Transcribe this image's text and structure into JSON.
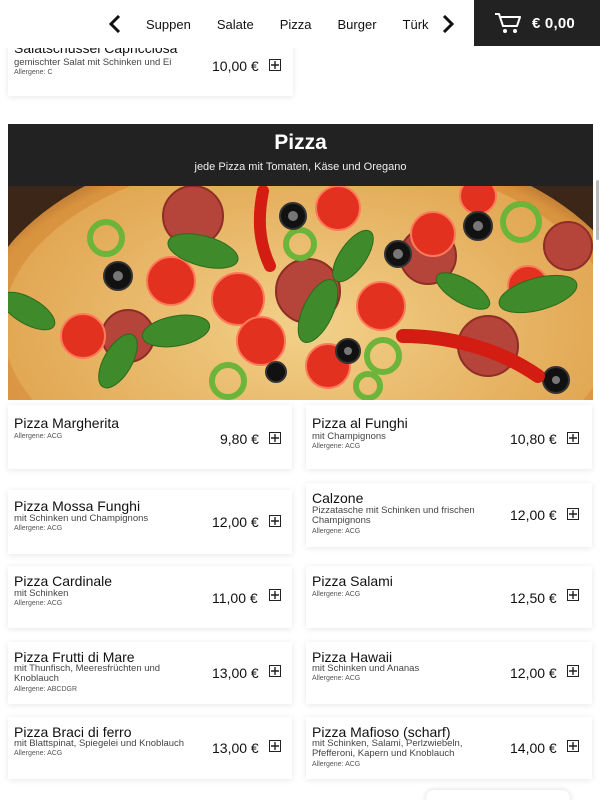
{
  "nav": {
    "categories": [
      "Suppen",
      "Salate",
      "Pizza",
      "Burger",
      "Türk"
    ]
  },
  "cart": {
    "total": "€ 0,00"
  },
  "previous_item": {
    "name": "Salatschüssel Capricciosa",
    "description": "gemischter Salat mit Schinken und Ei",
    "allergens": "Allergene: C",
    "price": "10,00 €"
  },
  "section": {
    "title": "Pizza",
    "subtitle": "jede Pizza mit Tomaten, Käse und Oregano"
  },
  "items": [
    {
      "name": "Pizza Margherita",
      "description": "",
      "allergens": "Allergene: ACG",
      "price": "9,80 €"
    },
    {
      "name": "Pizza al Funghi",
      "description": "mit Champignons",
      "allergens": "Allergene: ACG",
      "price": "10,80 €"
    },
    {
      "name": "Pizza Mossa Funghi",
      "description": "mit Schinken und Champignons",
      "allergens": "Allergene: ACG",
      "price": "12,00 €"
    },
    {
      "name": "Calzone",
      "description": "Pizzatasche mit Schinken und frischen Champignons",
      "allergens": "Allergene: ACG",
      "price": "12,00 €"
    },
    {
      "name": "Pizza Cardinale",
      "description": "mit Schinken",
      "allergens": "Allergene: ACG",
      "price": "11,00 €"
    },
    {
      "name": "Pizza Salami",
      "description": "",
      "allergens": "Allergene: ACG",
      "price": "12,50 €"
    },
    {
      "name": "Pizza Frutti di Mare",
      "description": "mit Thunfisch, Meeresfrüchten und Knoblauch",
      "allergens": "Allergene: ABCDGR",
      "price": "13,00 €"
    },
    {
      "name": "Pizza Hawaii",
      "description": "mit Schinken und Ananas",
      "allergens": "Allergene: ACG",
      "price": "12,00 €"
    },
    {
      "name": "Pizza Braci di ferro",
      "description": "mit Blattspinat, Spiegelei und Knoblauch",
      "allergens": "Allergene: ACG",
      "price": "13,00 €"
    },
    {
      "name": "Pizza Mafioso (scharf)",
      "description": "mit Schinken, Salami, Perlzwiebeln, Pfefferoni, Kapern und Knoblauch",
      "allergens": "Allergene: ACG",
      "price": "14,00 €"
    }
  ],
  "icons": {
    "prev": "chevron-left-icon",
    "next": "chevron-right-icon",
    "cart": "shopping-cart-icon",
    "add": "plus-square-icon"
  },
  "colors": {
    "dark": "#222222",
    "background": "#ffffff"
  }
}
